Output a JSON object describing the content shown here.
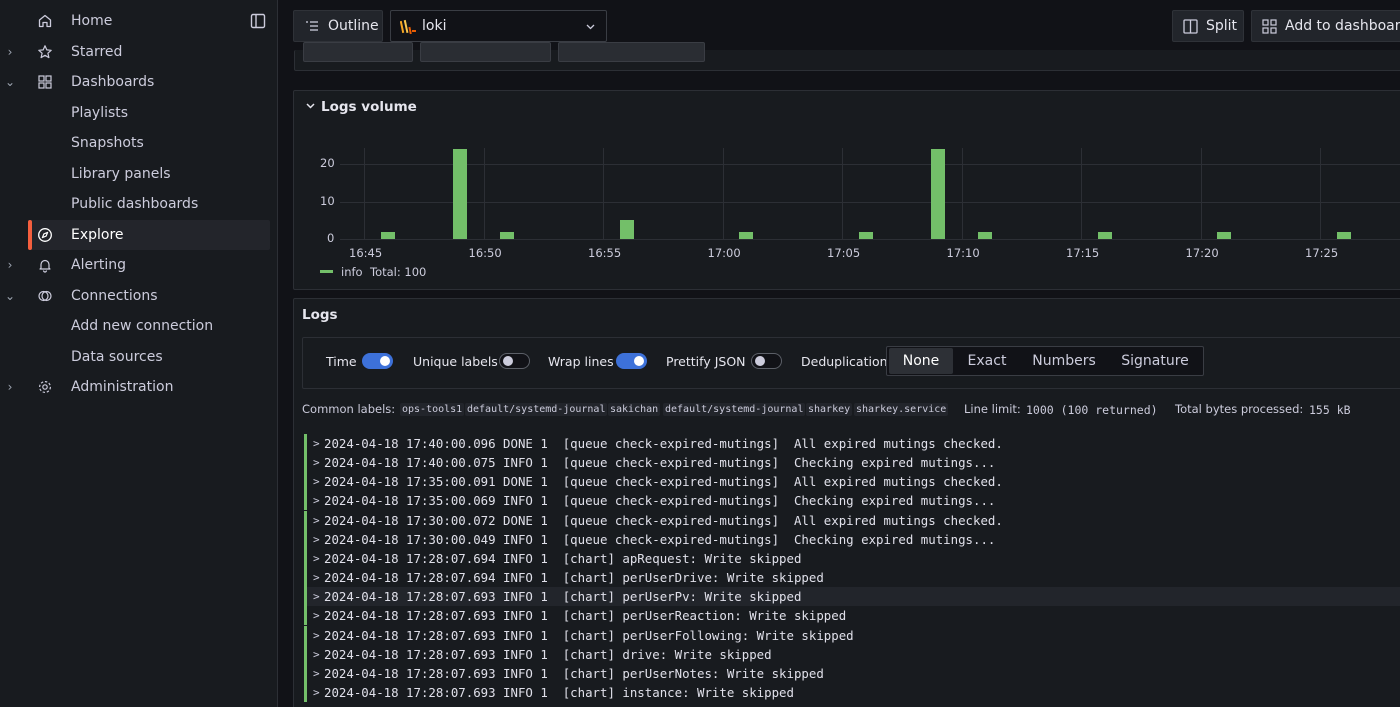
{
  "sidebar": {
    "items": [
      {
        "label": "Home",
        "icon": "home-icon",
        "chevron": ""
      },
      {
        "label": "Starred",
        "icon": "star-icon",
        "chevron": "›"
      },
      {
        "label": "Dashboards",
        "icon": "apps-icon",
        "chevron": "⌄"
      },
      {
        "label": "Playlists"
      },
      {
        "label": "Snapshots"
      },
      {
        "label": "Library panels"
      },
      {
        "label": "Public dashboards"
      },
      {
        "label": "Explore",
        "icon": "compass-icon",
        "active": true
      },
      {
        "label": "Alerting",
        "icon": "bell-icon",
        "chevron": "›"
      },
      {
        "label": "Connections",
        "icon": "connections-icon",
        "chevron": "⌄"
      },
      {
        "label": "Add new connection"
      },
      {
        "label": "Data sources"
      },
      {
        "label": "Administration",
        "icon": "cog-icon",
        "chevron": "›"
      }
    ]
  },
  "toolbar": {
    "outline_label": "Outline",
    "datasource": "loki",
    "split_label": "Split",
    "add_to_dashboard_label": "Add to dashboard"
  },
  "volume_panel": {
    "title": "Logs volume",
    "legend_series": "info",
    "legend_total": "Total: 100",
    "series_color": "#73bf69"
  },
  "chart_data": {
    "type": "bar",
    "title": "Logs volume",
    "y_ticks": [
      "0",
      "10",
      "20"
    ],
    "ylim": [
      0,
      27
    ],
    "x_tick_labels": [
      "16:45",
      "16:50",
      "16:55",
      "17:00",
      "17:05",
      "17:10",
      "17:15",
      "17:20",
      "17:25"
    ],
    "series": [
      {
        "name": "info",
        "points": [
          {
            "x": "16:46",
            "y": 2
          },
          {
            "x": "16:49",
            "y": 24
          },
          {
            "x": "16:51",
            "y": 2
          },
          {
            "x": "16:56",
            "y": 5
          },
          {
            "x": "17:01",
            "y": 2
          },
          {
            "x": "17:06",
            "y": 2
          },
          {
            "x": "17:09",
            "y": 24
          },
          {
            "x": "17:11",
            "y": 2
          },
          {
            "x": "17:16",
            "y": 2
          },
          {
            "x": "17:21",
            "y": 2
          },
          {
            "x": "17:26",
            "y": 2
          }
        ]
      }
    ]
  },
  "logs_panel": {
    "title": "Logs",
    "options": {
      "time": "Time",
      "unique_labels": "Unique labels",
      "wrap_lines": "Wrap lines",
      "prettify_json": "Prettify JSON",
      "deduplication": "Deduplication"
    },
    "dedup_options": [
      "None",
      "Exact",
      "Numbers",
      "Signature"
    ],
    "dedup_selected": "None",
    "common_labels_title": "Common labels:",
    "common_labels": [
      "ops-tools1",
      "default/systemd-journal",
      "sakichan",
      "default/systemd-journal",
      "sharkey",
      "sharkey.service"
    ],
    "line_limit_title": "Line limit:",
    "line_limit_value": "1000 (100 returned)",
    "total_bytes_title": "Total bytes processed:",
    "total_bytes_value": "155 kB",
    "rows": [
      "2024-04-18 17:40:00.096 DONE 1  [queue check-expired-mutings]  All expired mutings checked.",
      "2024-04-18 17:40:00.075 INFO 1  [queue check-expired-mutings]  Checking expired mutings...",
      "2024-04-18 17:35:00.091 DONE 1  [queue check-expired-mutings]  All expired mutings checked.",
      "2024-04-18 17:35:00.069 INFO 1  [queue check-expired-mutings]  Checking expired mutings...",
      "2024-04-18 17:30:00.072 DONE 1  [queue check-expired-mutings]  All expired mutings checked.",
      "2024-04-18 17:30:00.049 INFO 1  [queue check-expired-mutings]  Checking expired mutings...",
      "2024-04-18 17:28:07.694 INFO 1  [chart] apRequest: Write skipped",
      "2024-04-18 17:28:07.694 INFO 1  [chart] perUserDrive: Write skipped",
      "2024-04-18 17:28:07.693 INFO 1  [chart] perUserPv: Write skipped",
      "2024-04-18 17:28:07.693 INFO 1  [chart] perUserReaction: Write skipped",
      "2024-04-18 17:28:07.693 INFO 1  [chart] perUserFollowing: Write skipped",
      "2024-04-18 17:28:07.693 INFO 1  [chart] drive: Write skipped",
      "2024-04-18 17:28:07.693 INFO 1  [chart] perUserNotes: Write skipped",
      "2024-04-18 17:28:07.693 INFO 1  [chart] instance: Write skipped"
    ],
    "highlighted_row": 8
  }
}
